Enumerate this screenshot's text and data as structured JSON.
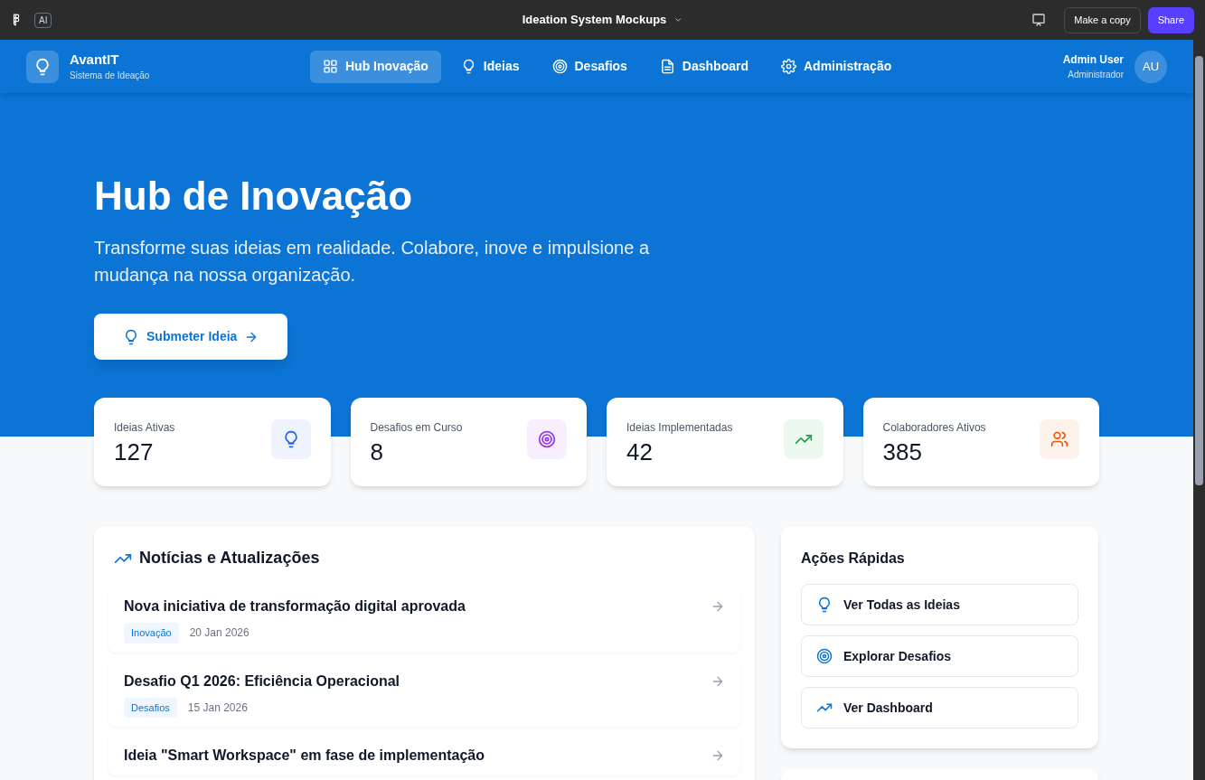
{
  "app_bar": {
    "badge": "AI",
    "title": "Ideation System Mockups",
    "buttons": [
      {
        "label": "Make a copy",
        "kind": "secondary"
      },
      {
        "label": "Share",
        "kind": "primary"
      }
    ]
  },
  "header": {
    "brand": "AvantIT",
    "subtitle": "Sistema de Ideação",
    "nav": [
      {
        "label": "Hub Inovação",
        "selected": true
      },
      {
        "label": "Ideias",
        "selected": false
      },
      {
        "label": "Desafios",
        "selected": false
      },
      {
        "label": "Dashboard",
        "selected": false
      },
      {
        "label": "Administração",
        "selected": false
      }
    ],
    "user": {
      "name": "Admin User",
      "role": "Administrador",
      "initials": "AU"
    }
  },
  "hero": {
    "title": "Hub de Inovação",
    "text": "Transforme suas ideias em realidade. Colabore, inove e impulsione a mudança na nossa organização.",
    "button": "Submeter Ideia"
  },
  "stats": [
    {
      "label": "Ideias Ativas",
      "value": "127",
      "color": "#2563eb"
    },
    {
      "label": "Desafios em Curso",
      "value": "8",
      "color": "#9333ea"
    },
    {
      "label": "Ideias Implementadas",
      "value": "42",
      "color": "#16a34a"
    },
    {
      "label": "Colaboradores Ativos",
      "value": "385",
      "color": "#ea580c"
    }
  ],
  "news": {
    "title": "Notícias e Atualizações",
    "items": [
      {
        "title": "Nova iniciativa de transformação digital aprovada",
        "tag": "Inovação",
        "date": "20 Jan 2026"
      },
      {
        "title": "Desafio Q1 2026: Eficiência Operacional",
        "tag": "Desafios",
        "date": "15 Jan 2026"
      },
      {
        "title": "Ideia \"Smart Workspace\" em fase de implementação"
      }
    ]
  },
  "quick_actions": {
    "title": "Ações Rápidas",
    "items": [
      "Ver Todas as Ideias",
      "Explorar Desafios",
      "Ver Dashboard"
    ]
  }
}
